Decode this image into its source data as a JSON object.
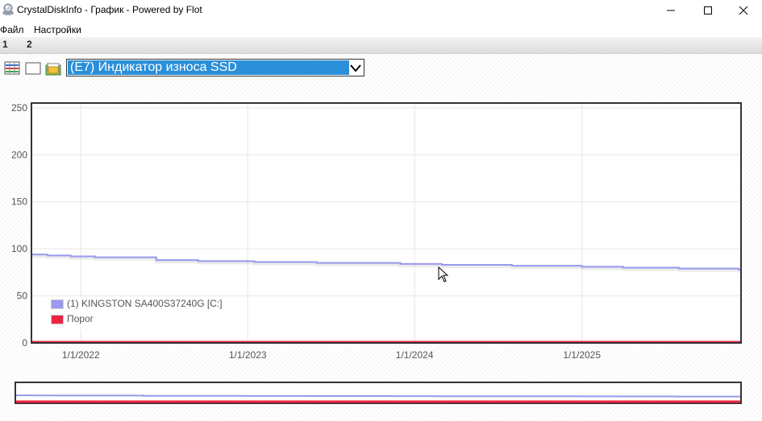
{
  "window": {
    "title": "CrystalDiskInfo - График - Powered by Flot",
    "icon": "crystaldiskinfo-app-icon",
    "controls": [
      "minimize-icon",
      "maximize-icon",
      "close-icon"
    ]
  },
  "menu": {
    "items": [
      "Файл",
      "Настройки"
    ]
  },
  "tabs": [
    "1",
    "2"
  ],
  "toolbar": {
    "icons": [
      "graph-icon",
      "blank-icon",
      "folder-icon"
    ],
    "attribute_select": {
      "selected": "(E7) Индикатор износа SSD"
    }
  },
  "chart_data": {
    "type": "line",
    "title": "",
    "xlabel": "",
    "ylabel": "",
    "x_ticks": [
      "1/1/2022",
      "1/1/2023",
      "1/1/2024",
      "1/1/2025"
    ],
    "y_ticks": [
      "0",
      "50",
      "100",
      "150",
      "200",
      "250"
    ],
    "ylim": [
      0,
      255
    ],
    "xlim": [
      "2021-09-15",
      "2025-12-15"
    ],
    "grid": true,
    "legend_position": "bottom-left",
    "series": [
      {
        "name": "(1) KINGSTON SA400S37240G [C:]",
        "color": "#9999ee",
        "step": true,
        "points": [
          [
            "2021-09-15",
            94
          ],
          [
            "2021-10-20",
            93
          ],
          [
            "2021-12-10",
            92
          ],
          [
            "2022-02-01",
            91
          ],
          [
            "2022-06-15",
            88
          ],
          [
            "2022-09-15",
            87
          ],
          [
            "2023-01-15",
            86
          ],
          [
            "2023-06-01",
            85
          ],
          [
            "2023-12-01",
            84
          ],
          [
            "2024-03-01",
            83
          ],
          [
            "2024-08-01",
            82
          ],
          [
            "2025-01-01",
            81
          ],
          [
            "2025-04-01",
            80
          ],
          [
            "2025-08-01",
            79
          ],
          [
            "2025-12-10",
            78
          ]
        ]
      },
      {
        "name": "Порог",
        "color": "#ee2244",
        "step": false,
        "points": [
          [
            "2021-09-15",
            0
          ],
          [
            "2025-12-15",
            0
          ]
        ]
      }
    ]
  }
}
